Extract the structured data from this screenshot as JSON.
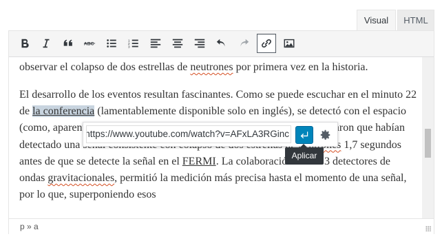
{
  "tabs": {
    "visual": "Visual",
    "html": "HTML"
  },
  "toolbar": {
    "buttons": [
      "bold-icon",
      "italic-icon",
      "blockquote-icon",
      "strikethrough-icon",
      "bullet-list-icon",
      "numbered-list-icon",
      "align-left-icon",
      "align-center-icon",
      "align-right-icon",
      "undo-icon",
      "redo-icon",
      "link-icon",
      "image-icon"
    ],
    "active": "link-icon"
  },
  "content": {
    "p1": "observar el colapso de dos estrellas de neutrones por primera vez en la historia.",
    "p1_word_neutrones": "neutrones",
    "p2_part1": "El desarrollo de los eventos resultan fascinantes. Como se puede escuchar en el minuto 22 de ",
    "p2_link": "la conferencia",
    "p2_part2": " (lamentablemente disponible solo en inglés), se detectó con el ",
    "p2_hidden_end": "espacio (como, aparentemente, sucede regularmente). Los ",
    "p2_part3": "avisaron que habían detectado una señal consistente con colapso de dos estrellas de ",
    "p2_word_neutrones": "neutrones",
    "p2_part4": " 1,7 segundos antes de que se detecte la señal en el ",
    "p2_fermi": "FERMI",
    "p2_part5": ". La colaboración de los 3 detectores de ondas ",
    "p2_word_grav": "gravitacionales",
    "p2_part6": ", permitió la medición más precisa hasta el momento de una señal, por lo que, superponiendo esos",
    "visible_fragments": {
      "espacio": "espacio",
      "ligo": "IGO y VIRGO",
      "como": "(como, aparente"
    }
  },
  "status": {
    "path": "p » a"
  },
  "link_popup": {
    "url": "https://www.youtube.com/watch?v=AFxLA3RGinc",
    "apply_tooltip": "Aplicar"
  },
  "colors": {
    "apply_button": "#0085ba",
    "highlight": "#c8d4df"
  }
}
